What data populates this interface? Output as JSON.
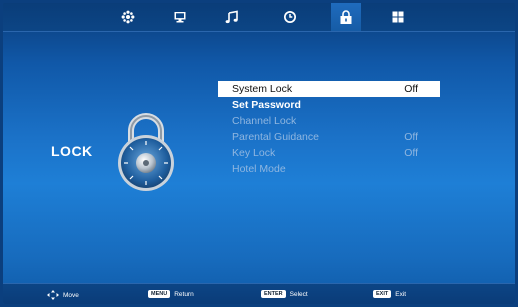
{
  "top_tabs": [
    {
      "icon": "picture-settings-icon"
    },
    {
      "icon": "monitor-icon"
    },
    {
      "icon": "music-note-icon"
    },
    {
      "icon": "clock-icon"
    },
    {
      "icon": "lock-icon",
      "active": true
    },
    {
      "icon": "grid-icon"
    }
  ],
  "page_title": "LOCK",
  "menu": [
    {
      "label": "System Lock",
      "value": "Off"
    },
    {
      "label": "Set Password",
      "value": ""
    },
    {
      "label": "Channel Lock",
      "value": ""
    },
    {
      "label": "Parental Guidance",
      "value": "Off"
    },
    {
      "label": "Key Lock",
      "value": "Off"
    },
    {
      "label": "Hotel Mode",
      "value": ""
    }
  ],
  "hints": {
    "move": {
      "label": "Move"
    },
    "menu": {
      "key": "MENU",
      "label": "Return"
    },
    "enter": {
      "key": "ENTER",
      "label": "Select"
    },
    "exit": {
      "key": "EXIT",
      "label": "Exit"
    }
  }
}
